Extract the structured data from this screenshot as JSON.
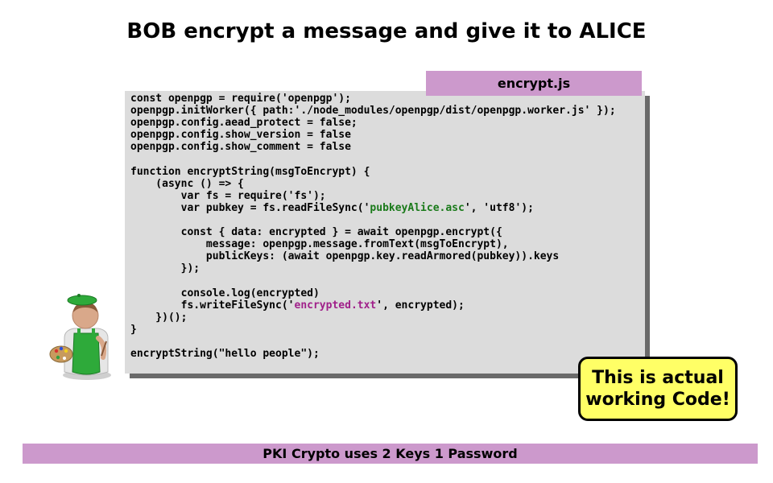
{
  "slide": {
    "title": "BOB encrypt a message and give it to ALICE"
  },
  "code_panel": {
    "filename": "encrypt.js",
    "lines": [
      [
        {
          "text": "const openpgp = require('openpgp');"
        }
      ],
      [
        {
          "text": "openpgp.initWorker({ path:'./node_modules/openpgp/dist/openpgp.worker.js' });"
        }
      ],
      [
        {
          "text": "openpgp.config.aead_protect = false;"
        }
      ],
      [
        {
          "text": "openpgp.config.show_version = false"
        }
      ],
      [
        {
          "text": "openpgp.config.show_comment = false"
        }
      ],
      [
        {
          "text": ""
        }
      ],
      [
        {
          "text": "function encryptString(msgToEncrypt) {"
        }
      ],
      [
        {
          "text": "    (async () => {"
        }
      ],
      [
        {
          "text": "        var fs = require('fs');"
        }
      ],
      [
        {
          "text": "        var pubkey = fs.readFileSync('"
        },
        {
          "text": "pubkeyAlice.asc",
          "style": "green"
        },
        {
          "text": "', 'utf8');"
        }
      ],
      [
        {
          "text": ""
        }
      ],
      [
        {
          "text": "        const { data: encrypted } = await openpgp.encrypt({"
        }
      ],
      [
        {
          "text": "            message: openpgp.message.fromText(msgToEncrypt),"
        }
      ],
      [
        {
          "text": "            publicKeys: (await openpgp.key.readArmored(pubkey)).keys"
        }
      ],
      [
        {
          "text": "        });"
        }
      ],
      [
        {
          "text": ""
        }
      ],
      [
        {
          "text": "        console.log(encrypted)"
        }
      ],
      [
        {
          "text": "        fs.writeFileSync('"
        },
        {
          "text": "encrypted.txt",
          "style": "purple"
        },
        {
          "text": "', encrypted);"
        }
      ],
      [
        {
          "text": "    })();"
        }
      ],
      [
        {
          "text": "}"
        }
      ],
      [
        {
          "text": ""
        }
      ],
      [
        {
          "text": "encryptString(\"hello people\");"
        }
      ]
    ]
  },
  "callout": {
    "line1": "This is actual",
    "line2": "working Code!"
  },
  "footer": {
    "text": "PKI Crypto uses 2 Keys 1 Password"
  },
  "colors": {
    "accent_bar": "#cc99cc",
    "code_background": "#dcdcdc",
    "callout_background": "#ffff66",
    "string_green": "#1a7a1a",
    "string_purple": "#a0208a"
  },
  "icons": {
    "presenter": "painter-with-palette-icon"
  }
}
